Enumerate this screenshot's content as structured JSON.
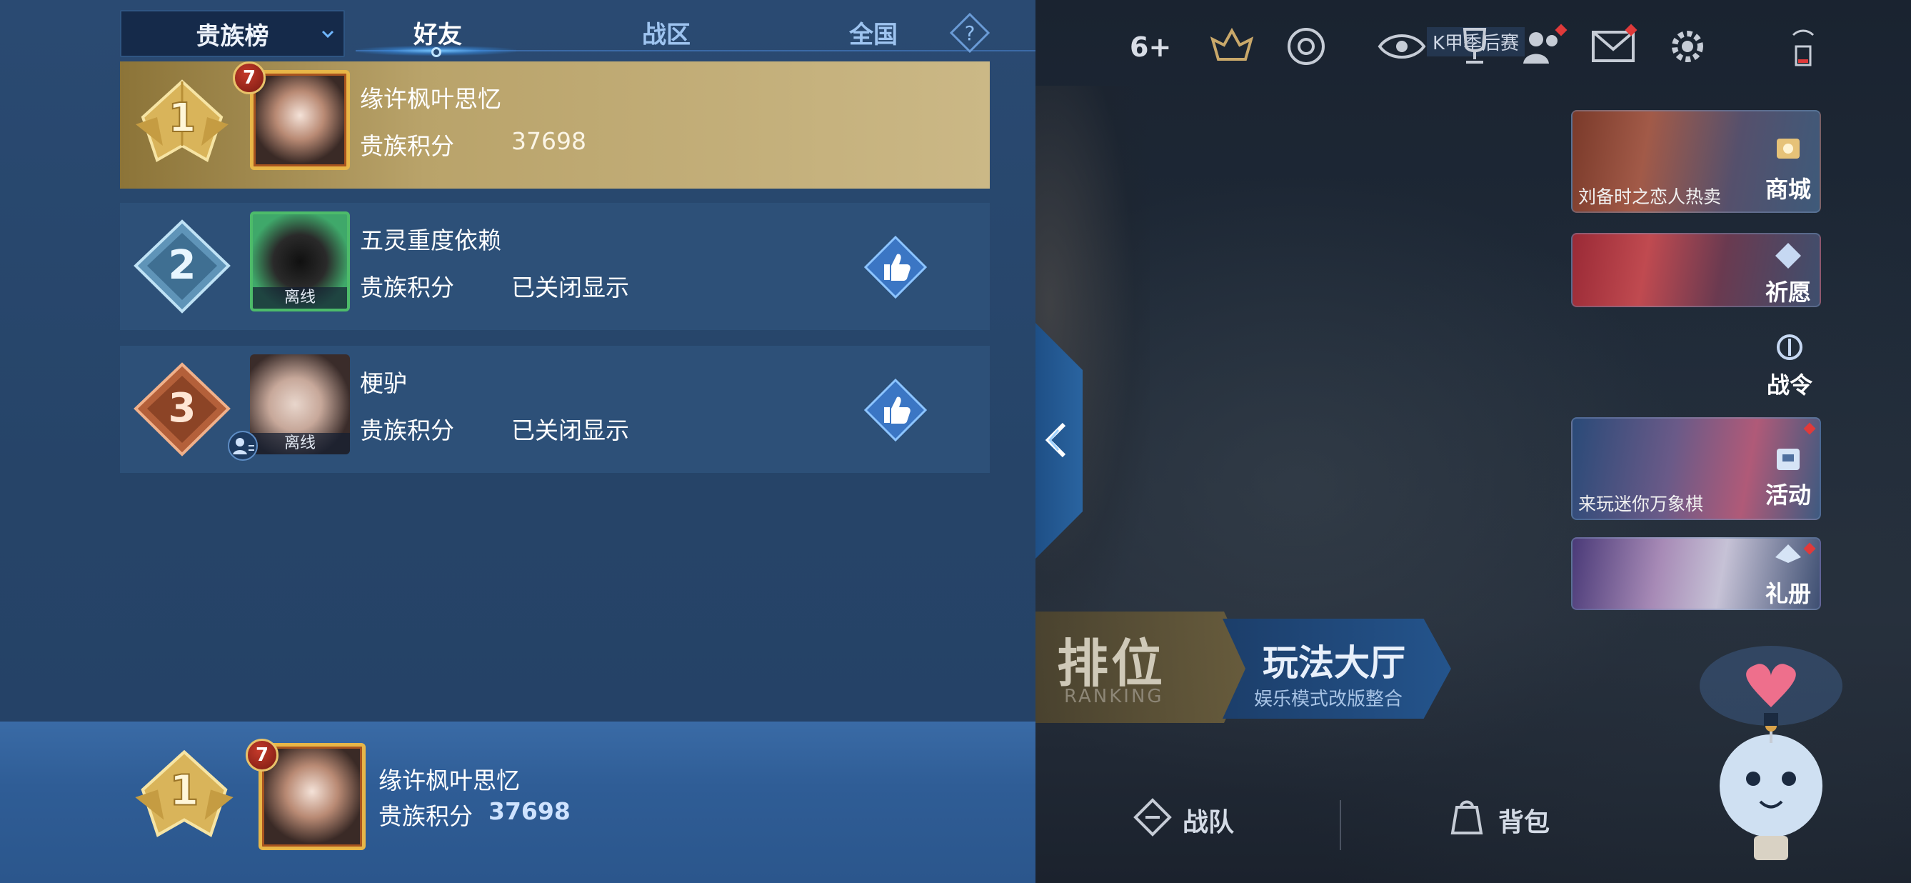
{
  "leaderboard": {
    "dropdown_label": "贵族榜",
    "tabs": [
      "好友",
      "战区",
      "全国"
    ],
    "active_tab": 0,
    "entries": [
      {
        "rank": "1",
        "name": "缘许枫叶思忆",
        "score_label": "贵族积分",
        "score": "37698",
        "level": "7",
        "offline_label": ""
      },
      {
        "rank": "2",
        "name": "五灵重度依赖",
        "score_label": "贵族积分",
        "score": "已关闭显示",
        "level": "",
        "offline_label": "离线"
      },
      {
        "rank": "3",
        "name": "梗驴",
        "score_label": "贵族积分",
        "score": "已关闭显示",
        "level": "",
        "offline_label": "离线"
      }
    ],
    "self": {
      "rank": "1",
      "name": "缘许枫叶思忆",
      "score_label": "贵族积分",
      "score": "37698",
      "level": "7"
    }
  },
  "game": {
    "top_count": "6+",
    "k_tag": "K甲季后赛",
    "cards": {
      "shop": {
        "label": "商城",
        "sub": "刘备时之恋人热卖"
      },
      "wish": {
        "label": "祈愿",
        "sub": ""
      },
      "pass": {
        "label": "战令",
        "sub": ""
      },
      "event": {
        "label": "活动",
        "sub": "来玩迷你万象棋"
      },
      "gift": {
        "label": "礼册",
        "sub": ""
      }
    },
    "ranked": {
      "main": "排位",
      "sub": "RANKING"
    },
    "lobby": {
      "main": "玩法大厅",
      "sub": "娱乐模式改版整合"
    },
    "bottom": {
      "team": "战队",
      "bag": "背包"
    }
  },
  "colors": {
    "gold": "#c9a44a",
    "panel": "#264468",
    "accent": "#3c8ee0",
    "reddot": "#e03a3a"
  }
}
